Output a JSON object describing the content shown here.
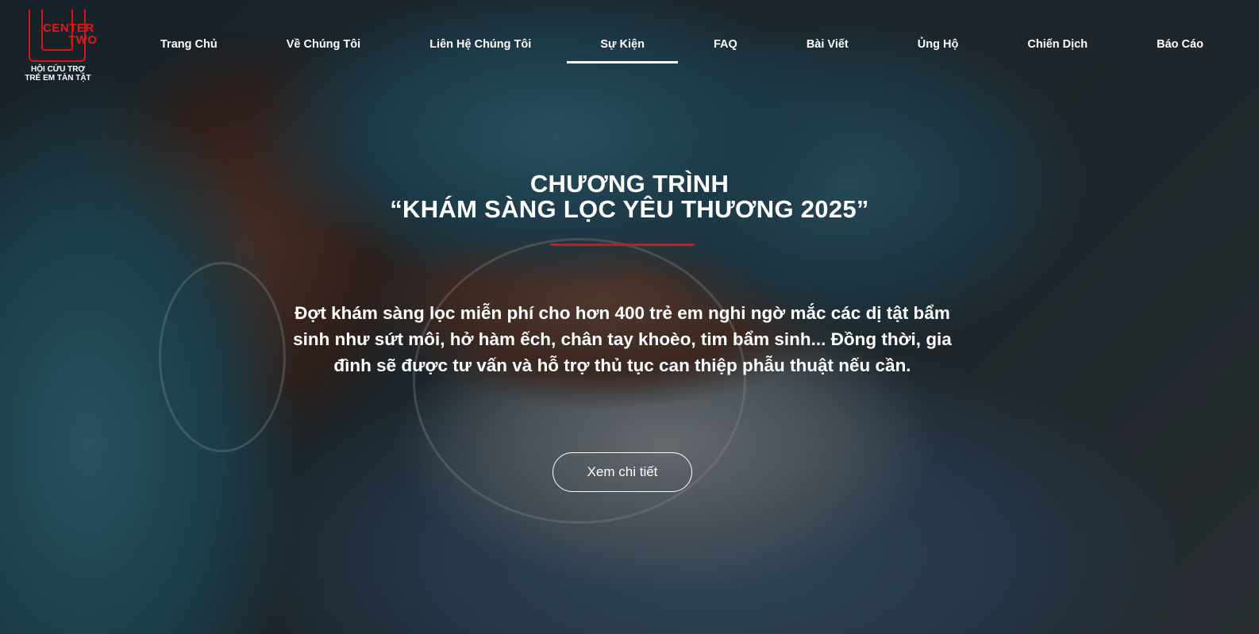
{
  "brand": {
    "logo_line_1": "CENTER",
    "logo_line_2": "TWO",
    "tagline_line_1": "HỘI CỨU TRỢ",
    "tagline_line_2": "TRẺ EM TÀN TẬT",
    "accent_color": "#d4151c"
  },
  "nav": {
    "items": [
      {
        "label": "Trang Chủ"
      },
      {
        "label": "Về Chúng Tôi"
      },
      {
        "label": "Liên Hệ Chúng Tôi"
      },
      {
        "label": "Sự Kiện"
      },
      {
        "label": "FAQ"
      },
      {
        "label": "Bài Viết"
      },
      {
        "label": "Ủng Hộ"
      },
      {
        "label": "Chiến Dịch"
      },
      {
        "label": "Báo Cáo"
      }
    ],
    "active_index": 3
  },
  "hero": {
    "title_line_1": "CHƯƠNG TRÌNH",
    "title_line_2": "“KHÁM SÀNG LỌC YÊU THƯƠNG 2025”",
    "description": "Đợt khám sàng lọc miễn phí cho hơn 400 trẻ em nghi ngờ mắc các dị tật bẩm sinh như sứt môi, hở hàm ếch, chân tay khoèo, tim bẩm sinh... Đồng thời, gia đình sẽ được tư vấn và hỗ trợ thủ tục can thiệp phẫu thuật nếu cần.",
    "cta_label": "Xem chi tiết"
  }
}
